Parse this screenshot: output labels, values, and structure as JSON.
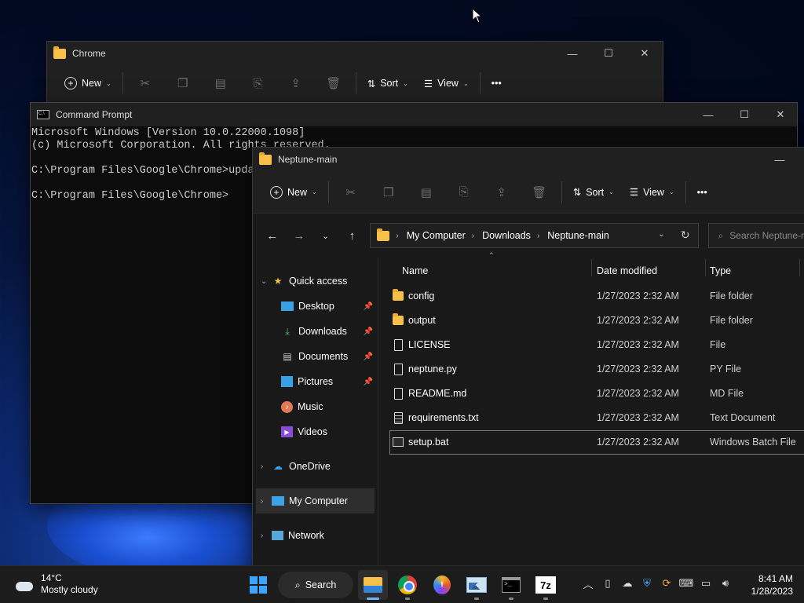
{
  "windows": {
    "back": {
      "title": "Chrome",
      "toolbar": {
        "new_label": "New",
        "sort_label": "Sort",
        "view_label": "View",
        "more_label": "•••"
      }
    },
    "cmd": {
      "title": "Command Prompt",
      "lines": [
        "Microsoft Windows [Version 10.0.22000.1098]",
        "(c) Microsoft Corporation. All rights reserved.",
        "",
        "C:\\Program Files\\Google\\Chrome>updat",
        "",
        "C:\\Program Files\\Google\\Chrome>"
      ]
    },
    "explorer": {
      "title": "Neptune-main",
      "toolbar": {
        "new_label": "New",
        "sort_label": "Sort",
        "view_label": "View",
        "more_label": "•••"
      },
      "breadcrumb": [
        "My Computer",
        "Downloads",
        "Neptune-main"
      ],
      "search_placeholder": "Search Neptune-main",
      "nav": {
        "quick_access": "Quick access",
        "items": [
          "Desktop",
          "Downloads",
          "Documents",
          "Pictures",
          "Music",
          "Videos"
        ],
        "onedrive": "OneDrive",
        "my_computer": "My Computer",
        "network": "Network"
      },
      "columns": {
        "name": "Name",
        "date": "Date modified",
        "type": "Type"
      },
      "files": [
        {
          "name": "config",
          "date": "1/27/2023 2:32 AM",
          "type": "File folder",
          "kind": "folder"
        },
        {
          "name": "output",
          "date": "1/27/2023 2:32 AM",
          "type": "File folder",
          "kind": "folder"
        },
        {
          "name": "LICENSE",
          "date": "1/27/2023 2:32 AM",
          "type": "File",
          "kind": "file"
        },
        {
          "name": "neptune.py",
          "date": "1/27/2023 2:32 AM",
          "type": "PY File",
          "kind": "file"
        },
        {
          "name": "README.md",
          "date": "1/27/2023 2:32 AM",
          "type": "MD File",
          "kind": "file"
        },
        {
          "name": "requirements.txt",
          "date": "1/27/2023 2:32 AM",
          "type": "Text Document",
          "kind": "text"
        },
        {
          "name": "setup.bat",
          "date": "1/27/2023 2:32 AM",
          "type": "Windows Batch File",
          "kind": "bat"
        }
      ]
    }
  },
  "taskbar": {
    "weather_temp": "14°C",
    "weather_desc": "Mostly cloudy",
    "search_label": "Search",
    "zip_label": "7z",
    "time": "8:41 AM",
    "date": "1/28/2023"
  }
}
